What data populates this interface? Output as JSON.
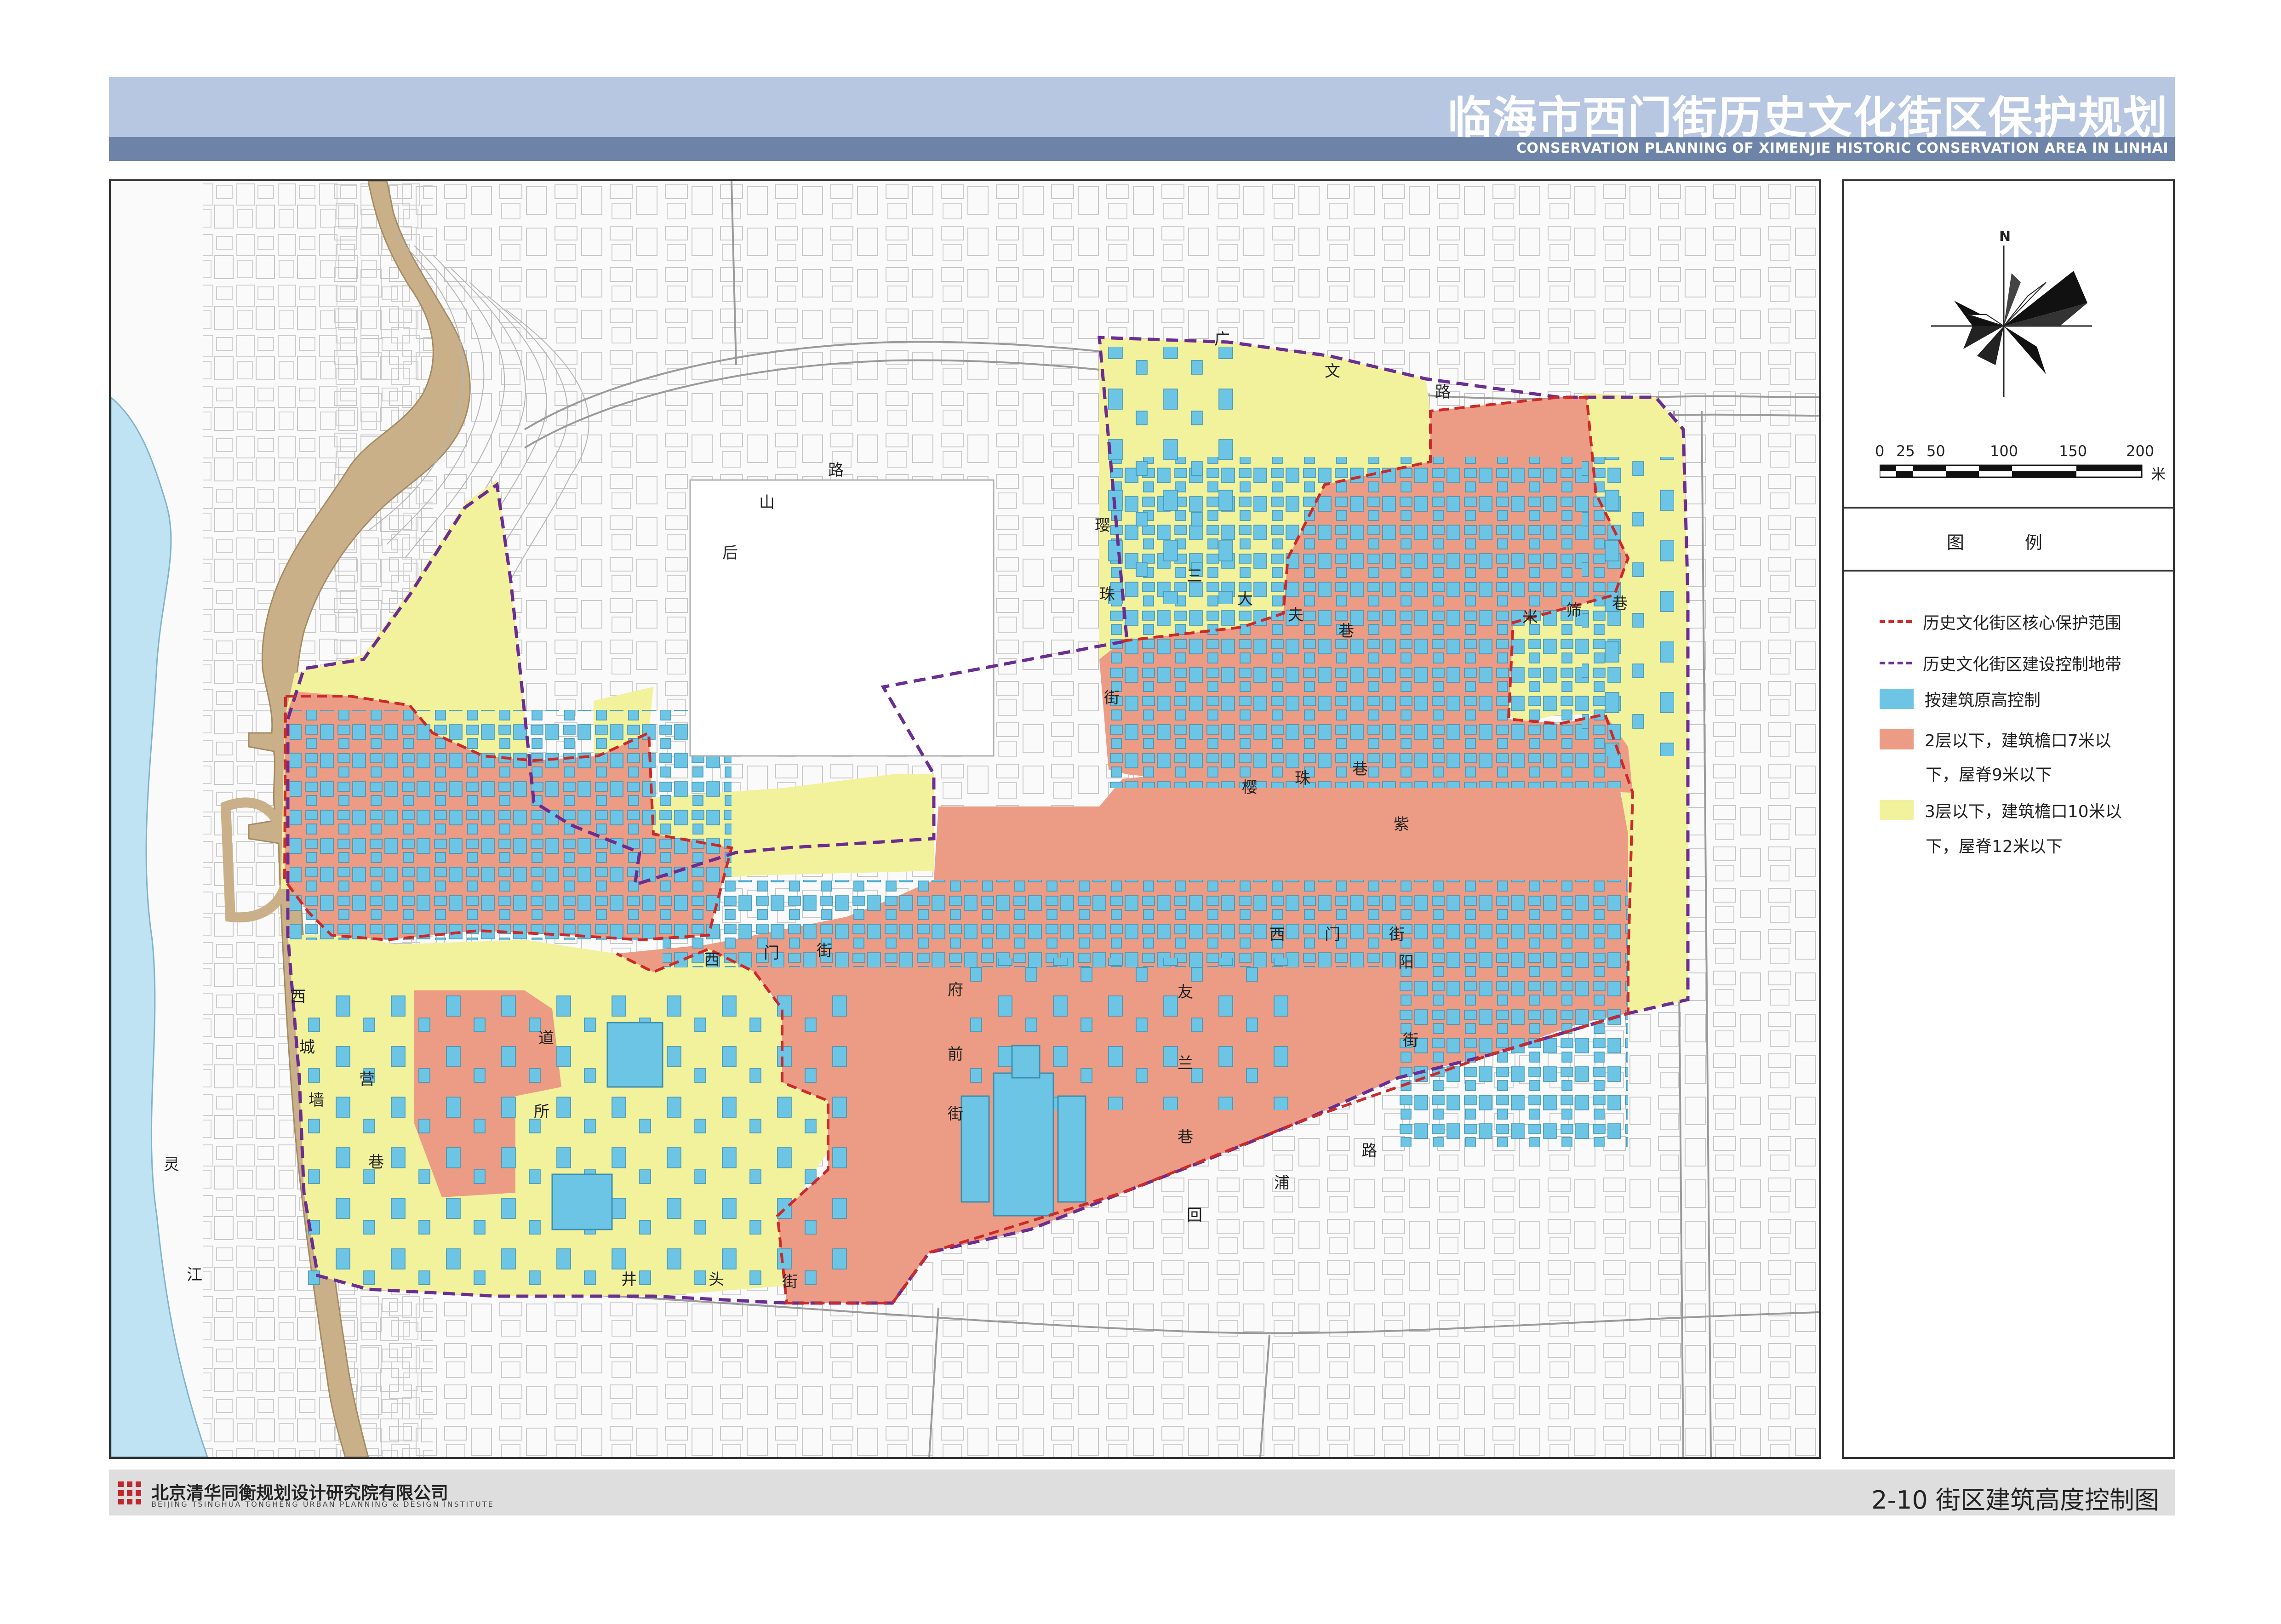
{
  "header": {
    "title": "临海市西门街历史文化街区保护规划",
    "subtitle": "CONSERVATION PLANNING OF XIMENJIE HISTORIC CONSERVATION AREA IN LINHAI"
  },
  "compass": {
    "north_label": "N"
  },
  "scale_bar": {
    "ticks": [
      "0",
      "25",
      "50",
      "100",
      "150",
      "200"
    ],
    "unit": "米"
  },
  "legend": {
    "title": "图  例",
    "items": [
      {
        "symbol": "dashed-red-line",
        "color": "#cc2a2a",
        "label": "历史文化街区核心保护范围"
      },
      {
        "symbol": "dashed-purple-line",
        "color": "#6b2d91",
        "label": "历史文化街区建设控制地带"
      },
      {
        "symbol": "fill",
        "color": "#6cc5e4",
        "label": "按建筑原高控制"
      },
      {
        "symbol": "fill",
        "color": "#ec9c84",
        "label": "2层以下，建筑檐口7米以",
        "label_cont": "下，屋脊9米以下"
      },
      {
        "symbol": "fill",
        "color": "#f2f19c",
        "label": "3层以下，建筑檐口10米以",
        "label_cont": "下，屋脊12米以下"
      }
    ]
  },
  "map_labels": {
    "river": [
      "灵",
      "江"
    ],
    "street_ximen": [
      "西",
      "门",
      "街"
    ],
    "street_guangwen": [
      "广",
      "文",
      "路"
    ],
    "street_houshan": [
      "后",
      "山",
      "路"
    ],
    "street_hui_pu": [
      "回",
      "浦",
      "路"
    ],
    "lane_sanmu": [
      "三"
    ],
    "lane_dafu": [
      "大",
      "夫",
      "巷"
    ],
    "lane_yingzhu": [
      "樱",
      "珠",
      "巷"
    ],
    "lane_fuqian": [
      "府",
      "前",
      "街"
    ],
    "lane_youlan": [
      "友",
      "兰",
      "巷"
    ],
    "lane_jingtou": [
      "井",
      "头",
      "街"
    ],
    "lane_ximen_west": [
      "西",
      "门",
      "街"
    ],
    "lane_xicheng": [
      "西",
      "城",
      "墙"
    ],
    "lane_ziyang": [
      "紫",
      "阳",
      "街"
    ],
    "lane_misha": [
      "米",
      "筛",
      "巷"
    ],
    "lane_other": [
      "璎",
      "珠",
      "街",
      "营",
      "所",
      "巷",
      "道"
    ]
  },
  "colors": {
    "core": "#ec9c84",
    "control": "#f2f19c",
    "original_height": "#6cc5e4",
    "river": "#bfe3f3",
    "wall": "#c9b089",
    "header_light": "#b7c7e2",
    "header_dark": "#6d84a8"
  },
  "footer": {
    "company_cn": "北京清华同衡规划设计研究院有限公司",
    "company_en": "BEIJING TSINGHUA TONGHENG URBAN PLANNING & DESIGN INSTITUTE",
    "drawing_title": "2-10 街区建筑高度控制图"
  }
}
